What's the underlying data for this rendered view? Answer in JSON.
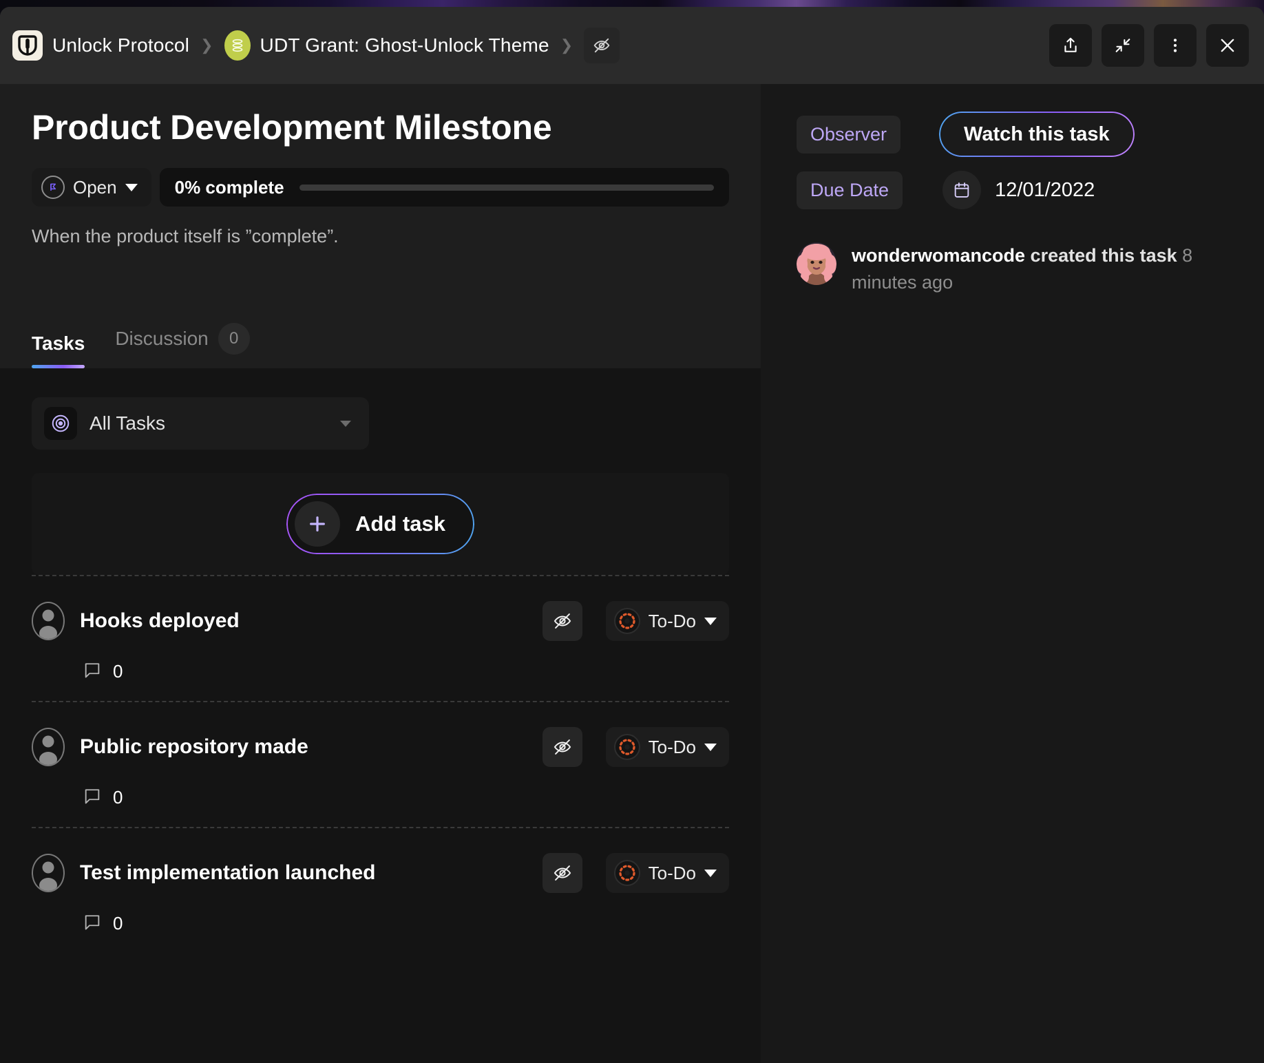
{
  "topbar": {
    "org_name": "Unlock Protocol",
    "project_name": "UDT Grant: Ghost-Unlock Theme",
    "separator": "❯",
    "actions": [
      {
        "name": "share-button",
        "icon": "share-icon"
      },
      {
        "name": "collapse-button",
        "icon": "collapse-arrows-icon"
      },
      {
        "name": "more-options-button",
        "icon": "kebab-menu-icon"
      },
      {
        "name": "close-button",
        "icon": "close-icon"
      }
    ],
    "visibility_icon": "eye-off-icon"
  },
  "task": {
    "title": "Product Development Milestone",
    "status": "Open",
    "progress_text": "0% complete",
    "progress_percent": 0,
    "description": "When the product itself is ”complete”."
  },
  "tabs": [
    {
      "label": "Tasks",
      "count": null,
      "active": true
    },
    {
      "label": "Discussion",
      "count": "0",
      "active": false
    }
  ],
  "filter": {
    "label": "All Tasks",
    "icon": "target-icon"
  },
  "add_task": {
    "label": "Add task",
    "icon": "plus-icon"
  },
  "subtasks": [
    {
      "title": "Hooks deployed",
      "status": "To-Do",
      "comments": "0"
    },
    {
      "title": "Public repository made",
      "status": "To-Do",
      "comments": "0"
    },
    {
      "title": "Test implementation launched",
      "status": "To-Do",
      "comments": "0"
    }
  ],
  "sidebar": {
    "observer_label": "Observer",
    "watch_button_label": "Watch this task",
    "due_date_label": "Due Date",
    "due_date_value": "12/01/2022",
    "activity": {
      "user": "wonderwomancode",
      "action": "created this task",
      "time": "8 minutes ago"
    }
  },
  "colors": {
    "accent_purple": "#8b5cf6",
    "accent_blue": "#4ea6ef",
    "chip_text": "#bda7f5",
    "todo_orange": "#e05a2b",
    "project_avatar": "#c0ce4b",
    "modal_bg": "#1e1e1e",
    "tasks_bg": "#141414",
    "sidebar_bg": "#181818"
  }
}
